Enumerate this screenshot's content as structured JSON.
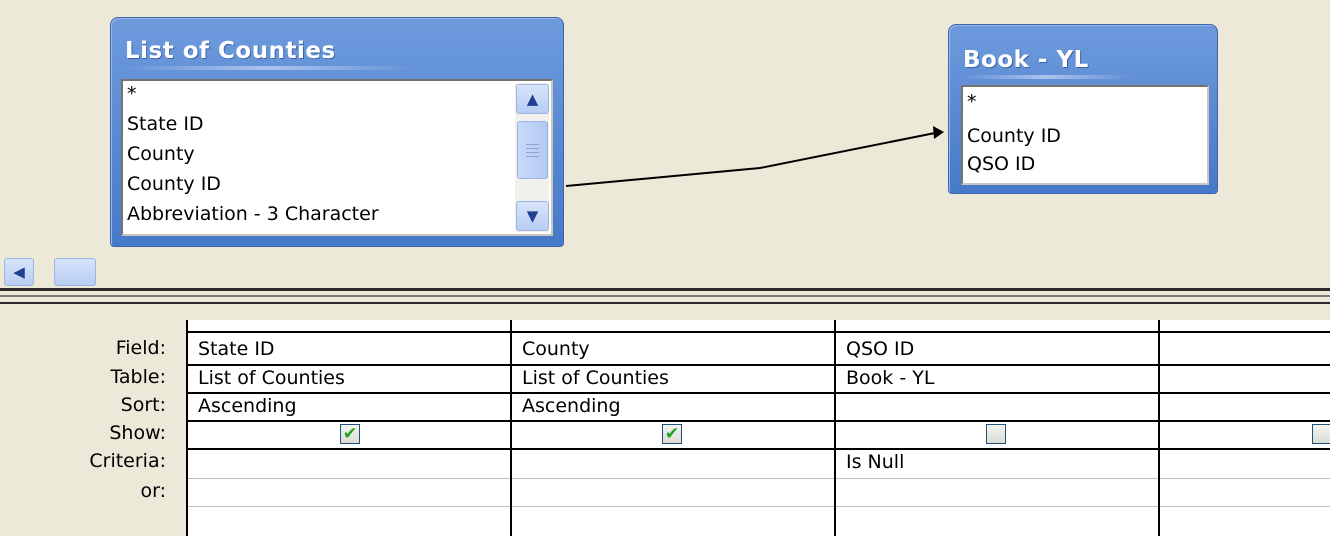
{
  "tables": [
    {
      "title": "List of Counties",
      "fields": [
        "*",
        "State ID",
        "County",
        "County ID",
        "Abbreviation - 3 Character"
      ]
    },
    {
      "title": "Book - YL",
      "fields": [
        "*",
        "County ID",
        "QSO ID"
      ]
    }
  ],
  "grid": {
    "row_labels": {
      "field": "Field:",
      "table": "Table:",
      "sort": "Sort:",
      "show": "Show:",
      "criteria": "Criteria:",
      "or": "or:"
    },
    "columns": [
      {
        "field": "State ID",
        "table": "List of Counties",
        "sort": "Ascending",
        "show": true,
        "criteria": ""
      },
      {
        "field": "County",
        "table": "List of Counties",
        "sort": "Ascending",
        "show": true,
        "criteria": ""
      },
      {
        "field": "QSO ID",
        "table": "Book - YL",
        "sort": "",
        "show": false,
        "criteria": "Is Null"
      },
      {
        "field": "",
        "table": "",
        "sort": "",
        "show": false,
        "criteria": ""
      }
    ]
  },
  "colors": {
    "window_bg": "#ECE9D8",
    "table_title_bg": "#4779C9",
    "check_mark": "#21A121"
  },
  "icons": {
    "scroll_up": "chevron-up-icon",
    "scroll_down": "chevron-down-icon",
    "scroll_left": "chevron-left-icon",
    "show_checked": "checkmark-icon"
  }
}
